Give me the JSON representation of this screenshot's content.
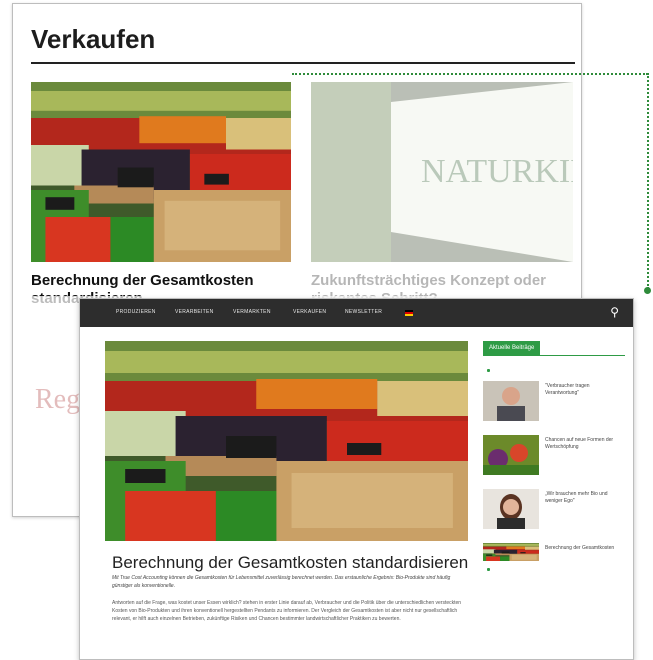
{
  "back": {
    "section_title": "Verkaufen",
    "caption_1": "Berechnung der Gesamtkosten standardisieren",
    "caption_2": "Zukunftsträchtiges Konzept oder riskantes Schritt?",
    "logo_text": "Reg",
    "sign_text": "NATURKIND"
  },
  "front": {
    "nav": [
      "PRODUZIEREN",
      "VERARBEITEN",
      "VERMARKTEN",
      "VERKAUFEN",
      "NEWSLETTER"
    ],
    "article_title": "Berechnung der Gesamtkosten standardisieren",
    "article_lead": "Mit True Cost Accounting können die Gesamtkosten für Lebensmittel zuverlässig berechnet werden. Das erstaunliche Ergebnis: Bio-Produkte sind häufig günstiger als konventionelle.",
    "article_body": "Antworten auf die Frage, was kostet unser Essen wirklich? stehen in erster Linie darauf ab, Verbraucher und die Politik über die unterschiedlichen versteckten Kosten von Bio-Produkten und ihren konventionell hergestellten Pendants zu informieren. Der Vergleich der Gesamtkosten ist aber nicht nur gesellschaftlich relevant, er hilft auch einzelnen Betrieben, zukünftige Risiken und Chancen bestimmter landwirtschaftlicher Praktiken zu bewerten.",
    "sidebar_tab": "Aktuelle Beiträge",
    "sidebar_items": [
      "\"Verbraucher tragen Verantwortung\"",
      "Chancen auf neue Formen der Wertschöpfung",
      "„Wir brauchen mehr Bio und weniger Ego\"",
      "Berechnung der Gesamtkosten"
    ]
  },
  "colors": {
    "accent": "#2e9b45",
    "nav_bg": "#2d2d2d"
  }
}
